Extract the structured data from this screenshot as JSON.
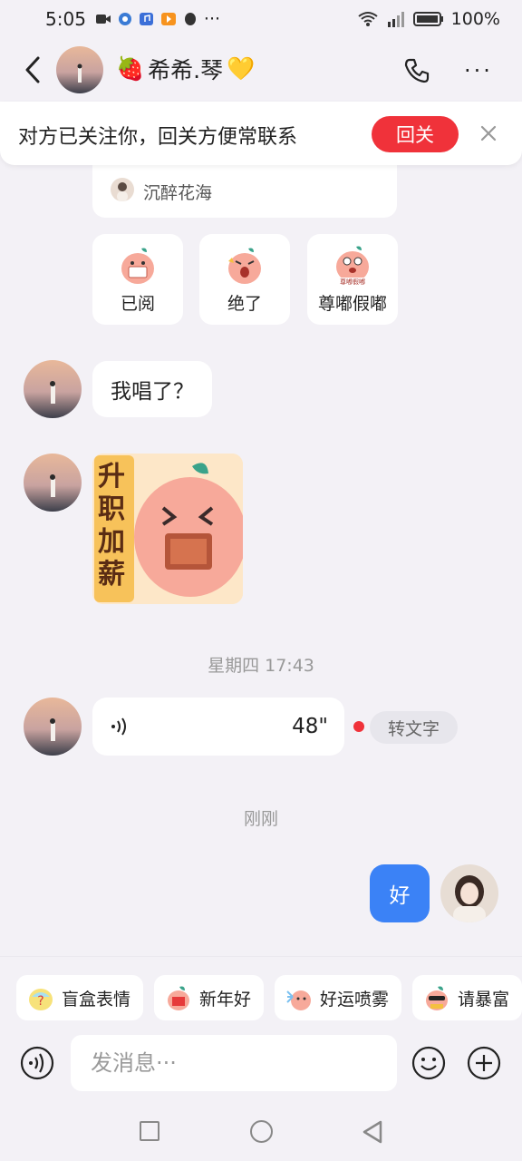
{
  "status_bar": {
    "time": "5:05",
    "battery": "100%"
  },
  "header": {
    "contact_name": "希希.琴",
    "name_prefix_emoji": "🍓",
    "name_suffix_emoji": "💛"
  },
  "follow_banner": {
    "text": "对方已关注你，回关方便常联系",
    "follow_back_label": "回关"
  },
  "messages": {
    "partial_card_source": "沉醉花海",
    "sticker_suggestions": [
      {
        "label": "已阅",
        "icon": "peach-reading-icon"
      },
      {
        "label": "绝了",
        "icon": "peach-amazed-icon"
      },
      {
        "label": "尊嘟假嘟",
        "icon": "peach-really-icon"
      }
    ],
    "text_message": "我唱了？",
    "big_sticker_text": "升职加薪",
    "timestamp_1": "星期四 17:43",
    "voice_length": "48\"",
    "transcribe_label": "转文字",
    "timestamp_2": "刚刚",
    "my_message": "好"
  },
  "quick_bar": {
    "chips": [
      {
        "label": "盲盒表情",
        "icon": "mystery-box-icon"
      },
      {
        "label": "新年好",
        "icon": "new-year-icon"
      },
      {
        "label": "好运喷雾",
        "icon": "lucky-spray-icon"
      },
      {
        "label": "请暴富",
        "icon": "get-rich-icon"
      }
    ],
    "input_placeholder": "发消息···"
  },
  "colors": {
    "accent_red": "#f0323a",
    "my_bubble_blue": "#3b82f6",
    "background": "#f3f1f6"
  }
}
